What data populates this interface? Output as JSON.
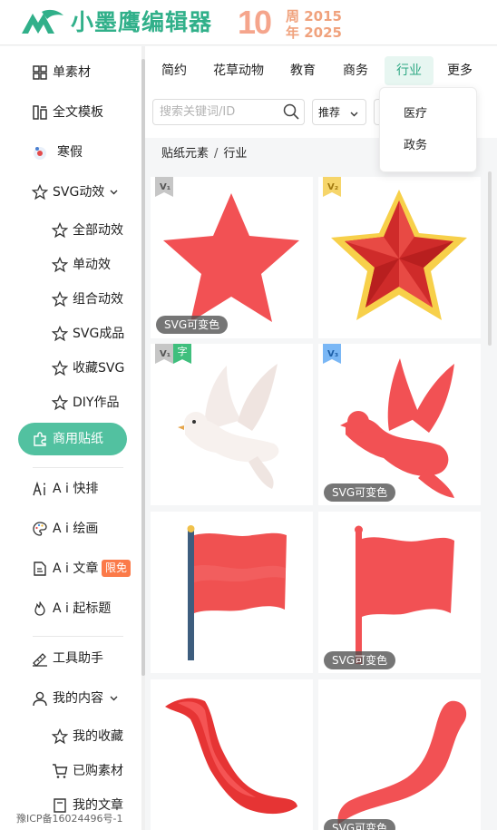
{
  "header": {
    "logo_text": "小墨鹰编辑器",
    "anniv_number": "10",
    "anniv_line1": "周 2015",
    "anniv_line2": "年 2025"
  },
  "sidebar": {
    "items": [
      {
        "label": "单素材",
        "icon": "grid-icon"
      },
      {
        "label": "全文模板",
        "icon": "template-icon"
      },
      {
        "label": "寒假",
        "icon": "holiday-icon"
      },
      {
        "label": "SVG动效",
        "icon": "star-outline-icon",
        "expanded": true
      },
      {
        "label": "全部动效",
        "icon": "star-outline-icon"
      },
      {
        "label": "单动效",
        "icon": "star-outline-icon"
      },
      {
        "label": "组合动效",
        "icon": "star-outline-icon"
      },
      {
        "label": "SVG成品",
        "icon": "star-outline-icon"
      },
      {
        "label": "收藏SVG",
        "icon": "star-outline-icon"
      },
      {
        "label": "DIY作品",
        "icon": "star-outline-icon"
      },
      {
        "label": "商用贴纸",
        "icon": "puzzle-icon",
        "active": true
      },
      {
        "label": "A i 快排",
        "icon": "ai-icon"
      },
      {
        "label": "A i 绘画",
        "icon": "palette-icon"
      },
      {
        "label": "A i 文章",
        "icon": "document-icon",
        "badge": "限免"
      },
      {
        "label": "A i 起标题",
        "icon": "flame-icon"
      },
      {
        "label": "工具助手",
        "icon": "tools-icon"
      },
      {
        "label": "我的内容",
        "icon": "user-icon",
        "expanded": true
      },
      {
        "label": "我的收藏",
        "icon": "star-outline-icon"
      },
      {
        "label": "已购素材",
        "icon": "cart-icon"
      },
      {
        "label": "我的文章",
        "icon": "document-icon"
      }
    ],
    "icp": "豫ICP备16024496号-1"
  },
  "tabs": [
    "简约",
    "花草动物",
    "教育",
    "商务",
    "行业",
    "更多"
  ],
  "active_tab": "行业",
  "dropdown": [
    "医疗",
    "政务"
  ],
  "search": {
    "placeholder": "搜索关键词/ID"
  },
  "sort": {
    "selected": "推荐"
  },
  "breadcrumb": [
    "贴纸元素",
    "行业"
  ],
  "cards": [
    {
      "name": "red-star",
      "tag": "V1",
      "badge": "SVG可变色"
    },
    {
      "name": "gold-star",
      "tag": "V2",
      "badge": ""
    },
    {
      "name": "white-dove",
      "tag": "V1",
      "tag2": "字",
      "badge": ""
    },
    {
      "name": "red-dove",
      "tag": "V3",
      "badge": "SVG可变色"
    },
    {
      "name": "red-flag-pole",
      "tag": "",
      "badge": ""
    },
    {
      "name": "flat-red-flag",
      "tag": "",
      "badge": "SVG可变色"
    },
    {
      "name": "red-ribbon",
      "tag": "",
      "badge": ""
    },
    {
      "name": "flat-red-ribbon",
      "tag": "",
      "badge": "SVG可变色"
    }
  ],
  "colors": {
    "brand_green": "#31b08a",
    "active_green": "#52c1a0",
    "sticker_red": "#f25154",
    "badge_orange": "#fb7a49"
  }
}
